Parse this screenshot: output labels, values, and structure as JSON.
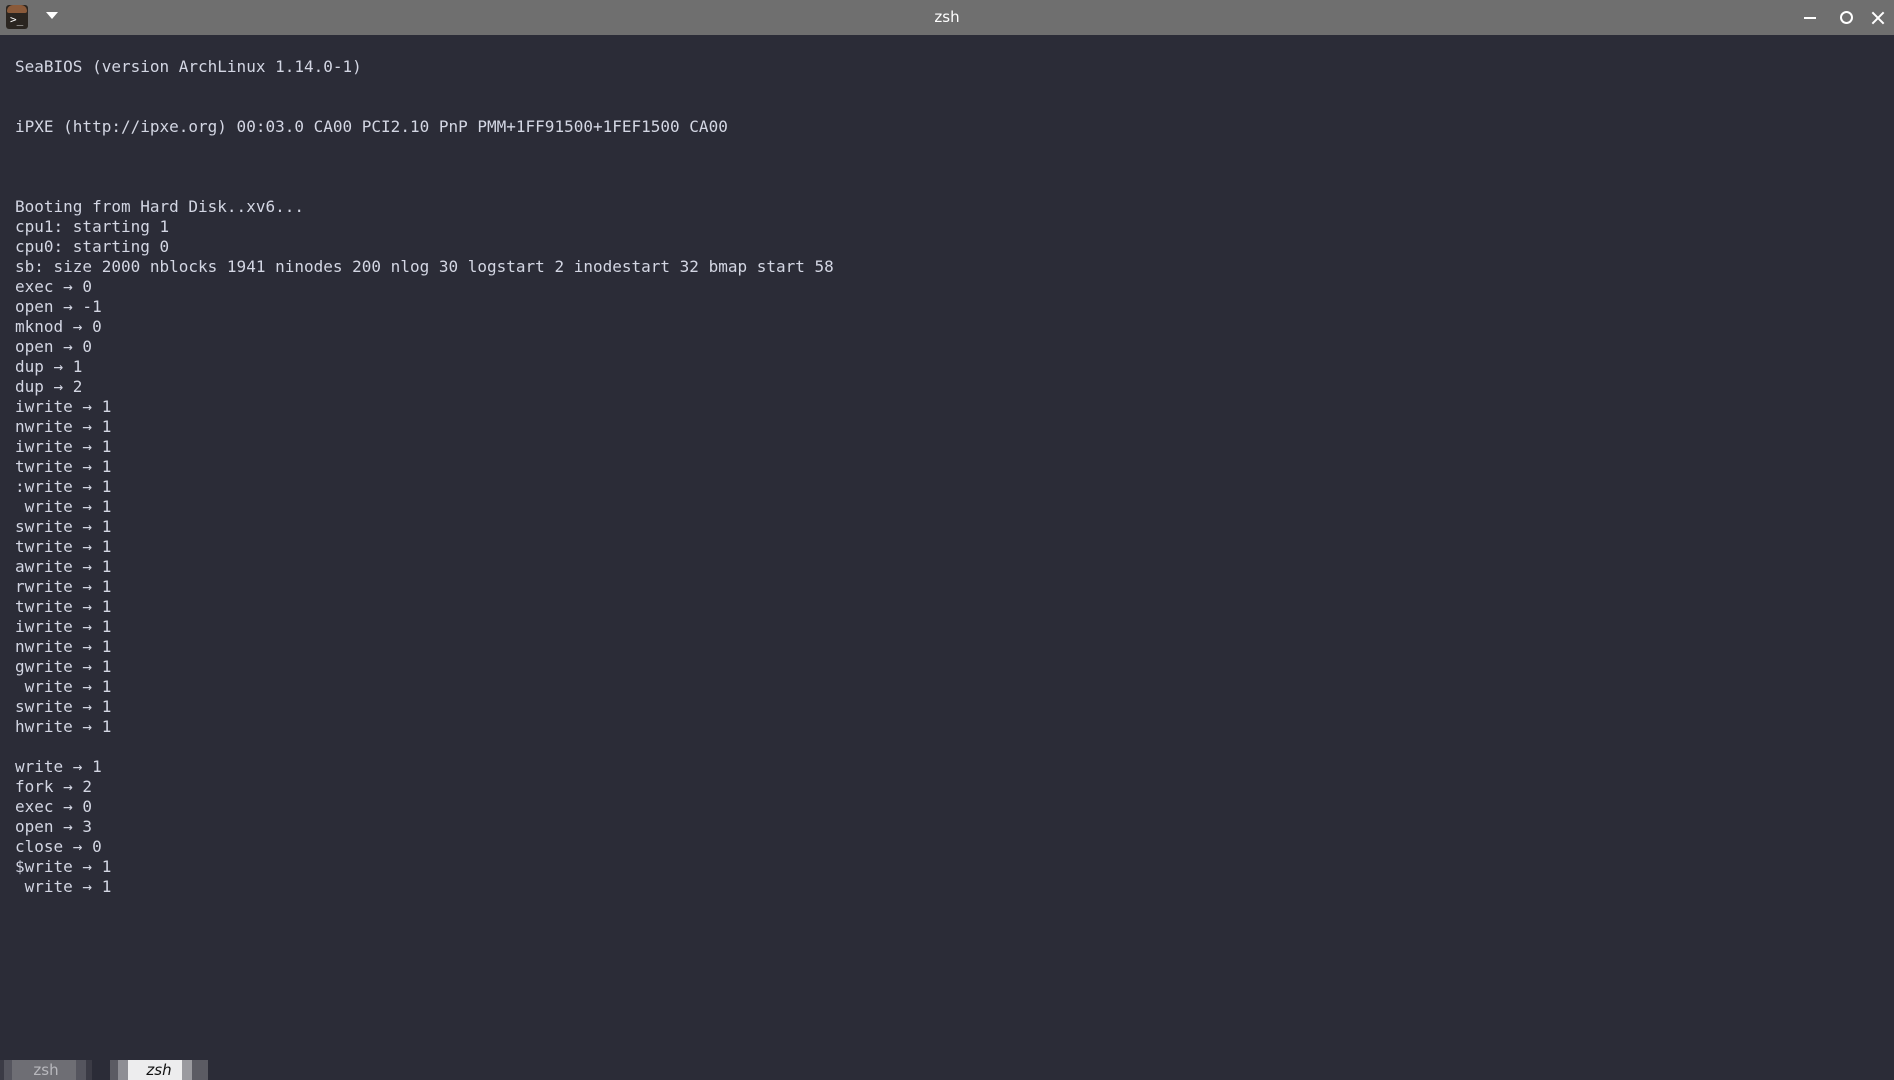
{
  "window": {
    "title": "zsh",
    "icon": "terminal-app-icon"
  },
  "terminal": {
    "lines": [
      "SeaBIOS (version ArchLinux 1.14.0-1)",
      "",
      "",
      "iPXE (http://ipxe.org) 00:03.0 CA00 PCI2.10 PnP PMM+1FF91500+1FEF1500 CA00",
      "",
      "",
      "",
      "Booting from Hard Disk..xv6...",
      "cpu1: starting 1",
      "cpu0: starting 0",
      "sb: size 2000 nblocks 1941 ninodes 200 nlog 30 logstart 2 inodestart 32 bmap start 58",
      "exec → 0",
      "open → -1",
      "mknod → 0",
      "open → 0",
      "dup → 1",
      "dup → 2",
      "iwrite → 1",
      "nwrite → 1",
      "iwrite → 1",
      "twrite → 1",
      ":write → 1",
      " write → 1",
      "swrite → 1",
      "twrite → 1",
      "awrite → 1",
      "rwrite → 1",
      "twrite → 1",
      "iwrite → 1",
      "nwrite → 1",
      "gwrite → 1",
      " write → 1",
      "swrite → 1",
      "hwrite → 1",
      "",
      "write → 1",
      "fork → 2",
      "exec → 0",
      "open → 3",
      "close → 0",
      "$write → 1",
      " write → 1"
    ]
  },
  "tabs": [
    {
      "label": "zsh",
      "active": false
    },
    {
      "label": "zsh",
      "active": true
    }
  ]
}
